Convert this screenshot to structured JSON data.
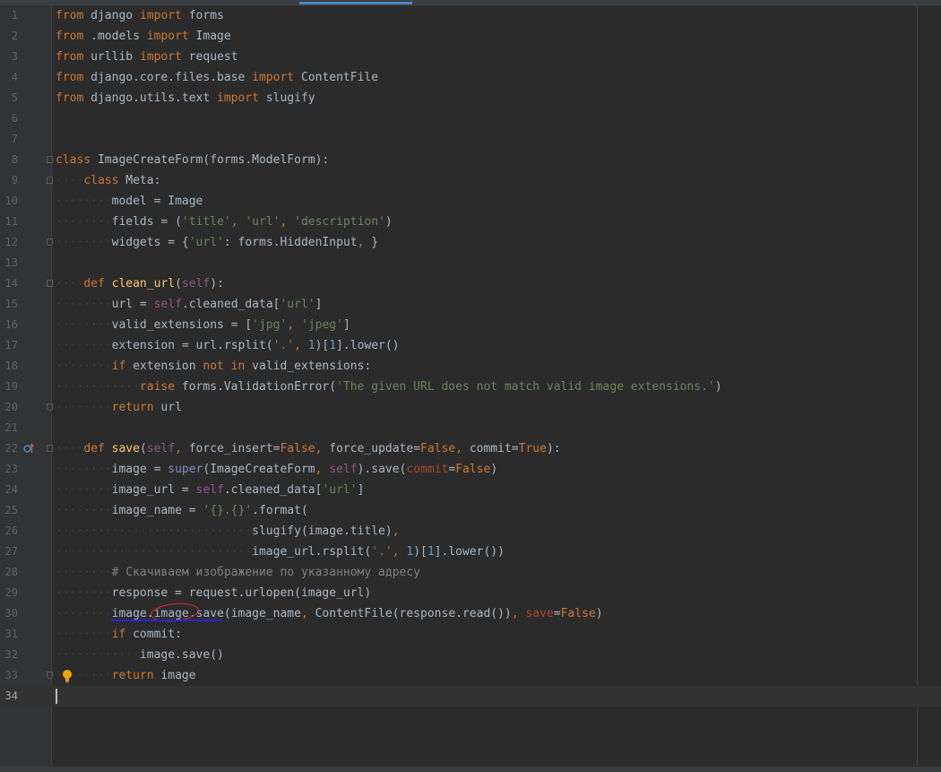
{
  "editor": {
    "language": "python",
    "current_line": 34
  },
  "colors": {
    "background": "#2b2b2b",
    "keyword": "#cc7832",
    "string": "#6a8759",
    "number": "#6897bb",
    "function": "#ffc66d",
    "self": "#94558d",
    "comment": "#808080",
    "annotation_circle": "#e0302a",
    "annotation_underline": "#2424d8"
  },
  "icons": {
    "line22": "override-method-icon",
    "line33": "lightbulb-icon"
  },
  "lines": [
    {
      "n": "1",
      "t": [
        [
          "k",
          "from"
        ],
        [
          "p",
          " django "
        ],
        [
          "k",
          "import"
        ],
        [
          "p",
          " forms"
        ]
      ]
    },
    {
      "n": "2",
      "t": [
        [
          "k",
          "from"
        ],
        [
          "p",
          " .models "
        ],
        [
          "k",
          "import"
        ],
        [
          "p",
          " Image"
        ]
      ]
    },
    {
      "n": "3",
      "t": [
        [
          "k",
          "from"
        ],
        [
          "p",
          " urllib "
        ],
        [
          "k",
          "import"
        ],
        [
          "p",
          " request"
        ]
      ]
    },
    {
      "n": "4",
      "t": [
        [
          "k",
          "from"
        ],
        [
          "p",
          " django.core.files.base "
        ],
        [
          "k",
          "import"
        ],
        [
          "p",
          " ContentFile"
        ]
      ]
    },
    {
      "n": "5",
      "t": [
        [
          "k",
          "from"
        ],
        [
          "p",
          " django.utils.text "
        ],
        [
          "k",
          "import"
        ],
        [
          "p",
          " slugify"
        ]
      ]
    },
    {
      "n": "6",
      "t": []
    },
    {
      "n": "7",
      "t": []
    },
    {
      "n": "8",
      "t": [
        [
          "k",
          "class"
        ],
        [
          "p",
          " ImageCreateForm(forms.ModelForm):"
        ]
      ]
    },
    {
      "n": "9",
      "t": [
        [
          "ws",
          "····"
        ],
        [
          "k",
          "class"
        ],
        [
          "p",
          " Meta:"
        ]
      ]
    },
    {
      "n": "10",
      "t": [
        [
          "ws",
          "········"
        ],
        [
          "p",
          "model = Image"
        ]
      ]
    },
    {
      "n": "11",
      "t": [
        [
          "ws",
          "········"
        ],
        [
          "p",
          "fields = ("
        ],
        [
          "s",
          "'title'"
        ],
        [
          "k",
          ", "
        ],
        [
          "s",
          "'url'"
        ],
        [
          "k",
          ", "
        ],
        [
          "s",
          "'description'"
        ],
        [
          "p",
          ")"
        ]
      ]
    },
    {
      "n": "12",
      "t": [
        [
          "ws",
          "········"
        ],
        [
          "p",
          "widgets = {"
        ],
        [
          "s",
          "'url'"
        ],
        [
          "p",
          ": forms.HiddenInput"
        ],
        [
          "k",
          ", "
        ],
        [
          "p",
          "}"
        ]
      ]
    },
    {
      "n": "13",
      "t": []
    },
    {
      "n": "14",
      "t": [
        [
          "ws",
          "····"
        ],
        [
          "k",
          "def "
        ],
        [
          "f",
          "clean_url"
        ],
        [
          "p",
          "("
        ],
        [
          "self",
          "self"
        ],
        [
          "p",
          "):"
        ]
      ]
    },
    {
      "n": "15",
      "t": [
        [
          "ws",
          "········"
        ],
        [
          "p",
          "url = "
        ],
        [
          "self",
          "self"
        ],
        [
          "p",
          ".cleaned_data["
        ],
        [
          "s",
          "'url'"
        ],
        [
          "p",
          "]"
        ]
      ]
    },
    {
      "n": "16",
      "t": [
        [
          "ws",
          "········"
        ],
        [
          "p",
          "valid_extensions = ["
        ],
        [
          "s",
          "'jpg'"
        ],
        [
          "k",
          ", "
        ],
        [
          "s",
          "'jpeg'"
        ],
        [
          "p",
          "]"
        ]
      ]
    },
    {
      "n": "17",
      "t": [
        [
          "ws",
          "········"
        ],
        [
          "p",
          "extension = url.rsplit("
        ],
        [
          "s",
          "'.'"
        ],
        [
          "k",
          ", "
        ],
        [
          "n",
          "1"
        ],
        [
          "p",
          ")["
        ],
        [
          "n",
          "1"
        ],
        [
          "p",
          "].lower()"
        ]
      ]
    },
    {
      "n": "18",
      "t": [
        [
          "ws",
          "········"
        ],
        [
          "k",
          "if"
        ],
        [
          "p",
          " extension "
        ],
        [
          "k",
          "not in"
        ],
        [
          "p",
          " valid_extensions:"
        ]
      ]
    },
    {
      "n": "19",
      "t": [
        [
          "ws",
          "············"
        ],
        [
          "k",
          "raise"
        ],
        [
          "p",
          " forms.ValidationError("
        ],
        [
          "s",
          "'The given URL does not match valid image extensions.'"
        ],
        [
          "p",
          ")"
        ]
      ]
    },
    {
      "n": "20",
      "t": [
        [
          "ws",
          "········"
        ],
        [
          "k",
          "return"
        ],
        [
          "p",
          " url"
        ]
      ]
    },
    {
      "n": "21",
      "t": []
    },
    {
      "n": "22",
      "t": [
        [
          "ws",
          "····"
        ],
        [
          "k",
          "def "
        ],
        [
          "f",
          "save"
        ],
        [
          "p",
          "("
        ],
        [
          "self",
          "self"
        ],
        [
          "k",
          ", "
        ],
        [
          "p",
          "force_insert="
        ],
        [
          "k",
          "False"
        ],
        [
          "k",
          ", "
        ],
        [
          "p",
          "force_update="
        ],
        [
          "k",
          "False"
        ],
        [
          "k",
          ", "
        ],
        [
          "p",
          "commit="
        ],
        [
          "k",
          "True"
        ],
        [
          "p",
          "):"
        ]
      ]
    },
    {
      "n": "23",
      "t": [
        [
          "ws",
          "········"
        ],
        [
          "p",
          "image = "
        ],
        [
          "bi",
          "super"
        ],
        [
          "p",
          "(ImageCreateForm"
        ],
        [
          "k",
          ", "
        ],
        [
          "self",
          "self"
        ],
        [
          "p",
          ").save("
        ],
        [
          "kw",
          "commit"
        ],
        [
          "p",
          "="
        ],
        [
          "k",
          "False"
        ],
        [
          "p",
          ")"
        ]
      ]
    },
    {
      "n": "24",
      "t": [
        [
          "ws",
          "········"
        ],
        [
          "p",
          "image_url = "
        ],
        [
          "self",
          "self"
        ],
        [
          "p",
          ".cleaned_data["
        ],
        [
          "s",
          "'url'"
        ],
        [
          "p",
          "]"
        ]
      ]
    },
    {
      "n": "25",
      "t": [
        [
          "ws",
          "········"
        ],
        [
          "p",
          "image_name = "
        ],
        [
          "s",
          "'{}.{}'"
        ],
        [
          "p",
          ".format("
        ]
      ]
    },
    {
      "n": "26",
      "t": [
        [
          "ws",
          "····························"
        ],
        [
          "p",
          "slugify(image.title)"
        ],
        [
          "k",
          ","
        ]
      ]
    },
    {
      "n": "27",
      "t": [
        [
          "ws",
          "····························"
        ],
        [
          "p",
          "image_url.rsplit("
        ],
        [
          "s",
          "'.'"
        ],
        [
          "k",
          ", "
        ],
        [
          "n",
          "1"
        ],
        [
          "p",
          ")["
        ],
        [
          "n",
          "1"
        ],
        [
          "p",
          "].lower())"
        ]
      ]
    },
    {
      "n": "28",
      "t": [
        [
          "ws",
          "········"
        ],
        [
          "c",
          "# Скачиваем изображение по указанному адресу"
        ]
      ]
    },
    {
      "n": "29",
      "t": [
        [
          "ws",
          "········"
        ],
        [
          "p",
          "response = request.urlopen(image_url)"
        ]
      ]
    },
    {
      "n": "30",
      "t": [
        [
          "ws",
          "········"
        ],
        [
          "p",
          "image.image.save(image_name"
        ],
        [
          "k",
          ", "
        ],
        [
          "p",
          "ContentFile(response.read())"
        ],
        [
          "k",
          ", "
        ],
        [
          "kw",
          "save"
        ],
        [
          "p",
          "="
        ],
        [
          "k",
          "False"
        ],
        [
          "p",
          ")"
        ]
      ]
    },
    {
      "n": "31",
      "t": [
        [
          "ws",
          "········"
        ],
        [
          "k",
          "if"
        ],
        [
          "p",
          " commit:"
        ]
      ]
    },
    {
      "n": "32",
      "t": [
        [
          "ws",
          "············"
        ],
        [
          "p",
          "image.save()"
        ]
      ]
    },
    {
      "n": "33",
      "t": [
        [
          "ws",
          "········"
        ],
        [
          "k",
          "return"
        ],
        [
          "p",
          " image"
        ]
      ]
    },
    {
      "n": "34",
      "t": []
    }
  ]
}
